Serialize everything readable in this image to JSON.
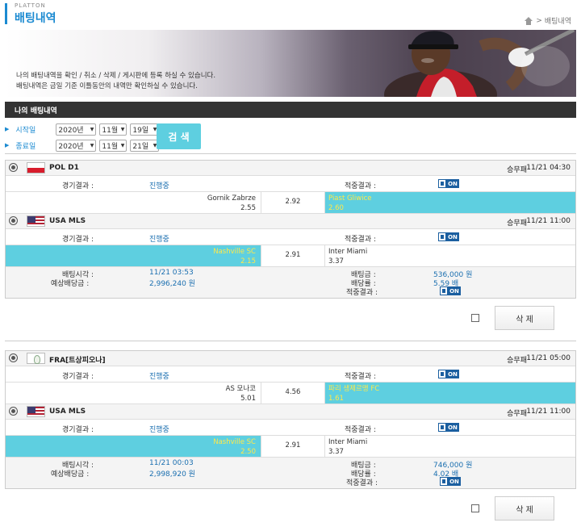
{
  "header": {
    "brand": "PLATTON",
    "title": "배팅내역",
    "breadcrumb": "배팅내역"
  },
  "banner": {
    "line1": "나의 배팅내역을 확인 / 취소 / 삭제 / 게시판에 등록 하실 수 있습니다.",
    "line2": "배팅내역은 금일 기준 이틀동안의 내역만 확인하실 수 있습니다."
  },
  "section": {
    "title": "나의 배팅내역"
  },
  "filter": {
    "start_label": "시작일",
    "end_label": "종료일",
    "start": {
      "year": "2020년",
      "month": "11월",
      "day": "19일"
    },
    "end": {
      "year": "2020년",
      "month": "11월",
      "day": "21일"
    },
    "search_label": "검 색"
  },
  "labels": {
    "result": "경기결과 :",
    "hit": "적중결과 :",
    "bet_time": "배팅시각 :",
    "expected": "예상배당금 :",
    "bet_amount": "배팅금 :",
    "odds_rate": "배당률 :",
    "delete": "삭 제",
    "on": "ON"
  },
  "bets": [
    {
      "games": [
        {
          "league": "POL D1",
          "type": "승무패",
          "time": "11/21 04:30",
          "status": "진행중",
          "home": "Gornik Zabrze",
          "home_odds": "2.55",
          "draw": "2.92",
          "away": "Piast Gliwice",
          "away_odds": "2.60"
        },
        {
          "league": "USA MLS",
          "type": "승무패",
          "time": "11/21 11:00",
          "status": "진행중",
          "home": "Nashville SC",
          "home_odds": "2.15",
          "draw": "2.91",
          "away": "Inter Miami",
          "away_odds": "3.37"
        }
      ],
      "bet_time": "11/21 03:53",
      "expected": "2,996,240 원",
      "amount": "536,000 원",
      "rate": "5.59 배"
    },
    {
      "games": [
        {
          "league": "FRA[트상피오나]",
          "type": "승무패",
          "time": "11/21 05:00",
          "status": "진행중",
          "home": "AS 모나코",
          "home_odds": "5.01",
          "draw": "4.56",
          "away": "파리 생제르맹 FC",
          "away_odds": "1.61"
        },
        {
          "league": "USA MLS",
          "type": "승무패",
          "time": "11/21 11:00",
          "status": "진행중",
          "home": "Nashville SC",
          "home_odds": "2.50",
          "draw": "2.91",
          "away": "Inter Miami",
          "away_odds": "3.37"
        }
      ],
      "bet_time": "11/21 00:03",
      "expected": "2,998,920 원",
      "amount": "746,000 원",
      "rate": "4.02 배"
    }
  ]
}
